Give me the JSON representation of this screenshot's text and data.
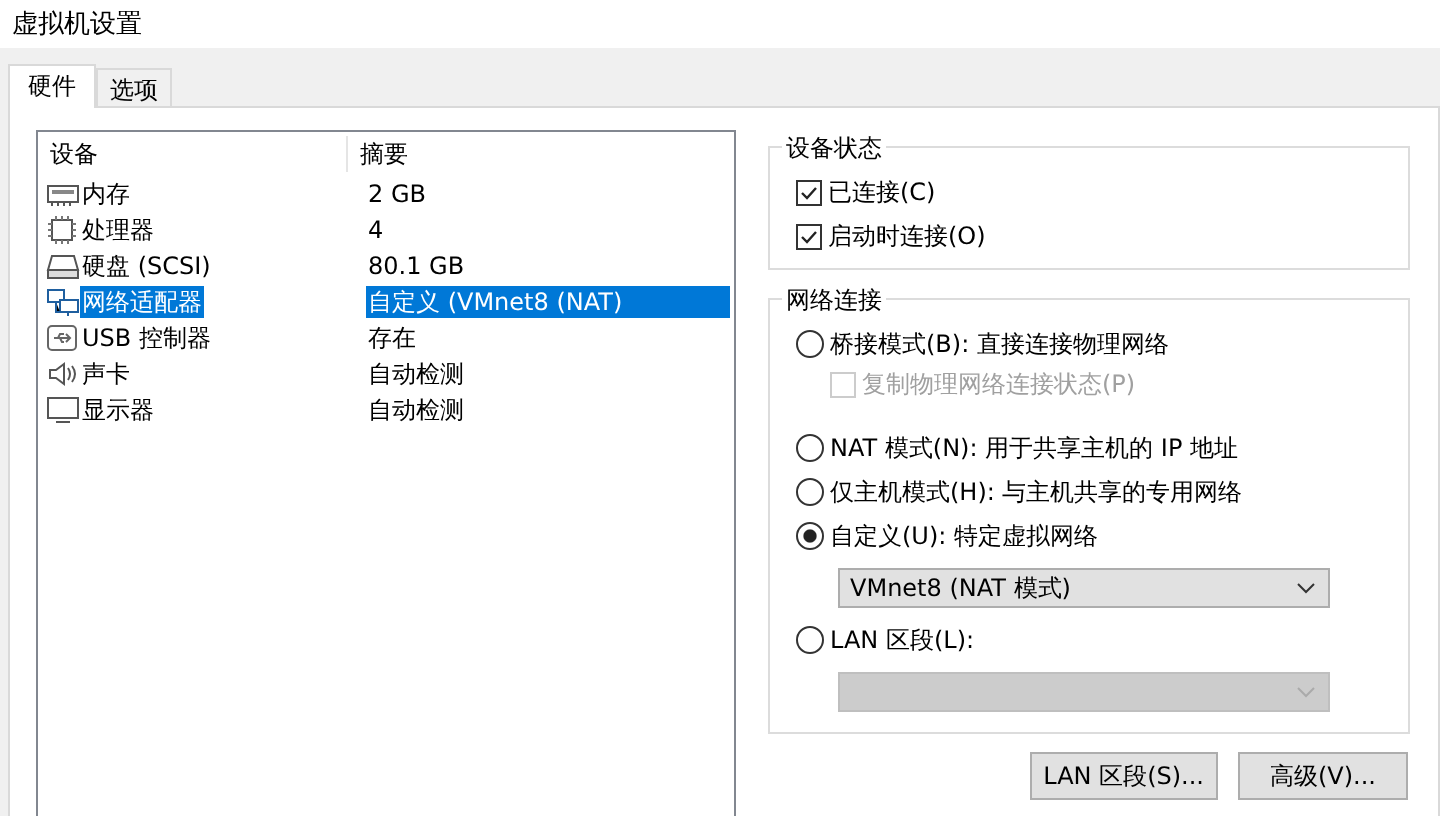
{
  "window": {
    "title": "虚拟机设置"
  },
  "tabs": [
    {
      "label": "硬件",
      "selected": true
    },
    {
      "label": "选项",
      "selected": false
    }
  ],
  "devices": {
    "columns": [
      "设备",
      "摘要"
    ],
    "rows": [
      {
        "kind": "memory",
        "name": "内存",
        "summary": "2 GB",
        "selected": false
      },
      {
        "kind": "cpu",
        "name": "处理器",
        "summary": "4",
        "selected": false
      },
      {
        "kind": "disk",
        "name": "硬盘 (SCSI)",
        "summary": "80.1 GB",
        "selected": false
      },
      {
        "kind": "network",
        "name": "网络适配器",
        "summary": "自定义 (VMnet8 (NAT)",
        "selected": true
      },
      {
        "kind": "usb",
        "name": "USB 控制器",
        "summary": "存在",
        "selected": false
      },
      {
        "kind": "sound",
        "name": "声卡",
        "summary": "自动检测",
        "selected": false
      },
      {
        "kind": "display",
        "name": "显示器",
        "summary": "自动检测",
        "selected": false
      }
    ]
  },
  "device_status": {
    "title": "设备状态",
    "checkboxes": [
      {
        "label": "已连接(C)",
        "checked": true
      },
      {
        "label": "启动时连接(O)",
        "checked": true
      }
    ]
  },
  "network_connection": {
    "title": "网络连接",
    "options": [
      {
        "label": "桥接模式(B): 直接连接物理网络",
        "selected": false,
        "checkbox": {
          "label": "复制物理网络连接状态(P)",
          "checked": false,
          "disabled": true
        }
      },
      {
        "label": "NAT 模式(N): 用于共享主机的 IP 地址",
        "selected": false
      },
      {
        "label": "仅主机模式(H): 与主机共享的专用网络",
        "selected": false
      },
      {
        "label": "自定义(U): 特定虚拟网络",
        "selected": true,
        "dropdown": {
          "value": "VMnet8 (NAT 模式)",
          "disabled": false
        }
      },
      {
        "label": "LAN 区段(L):",
        "selected": false,
        "dropdown": {
          "disabled": true
        }
      }
    ]
  },
  "buttons": [
    "LAN 区段(S)...",
    "高级(V)..."
  ]
}
